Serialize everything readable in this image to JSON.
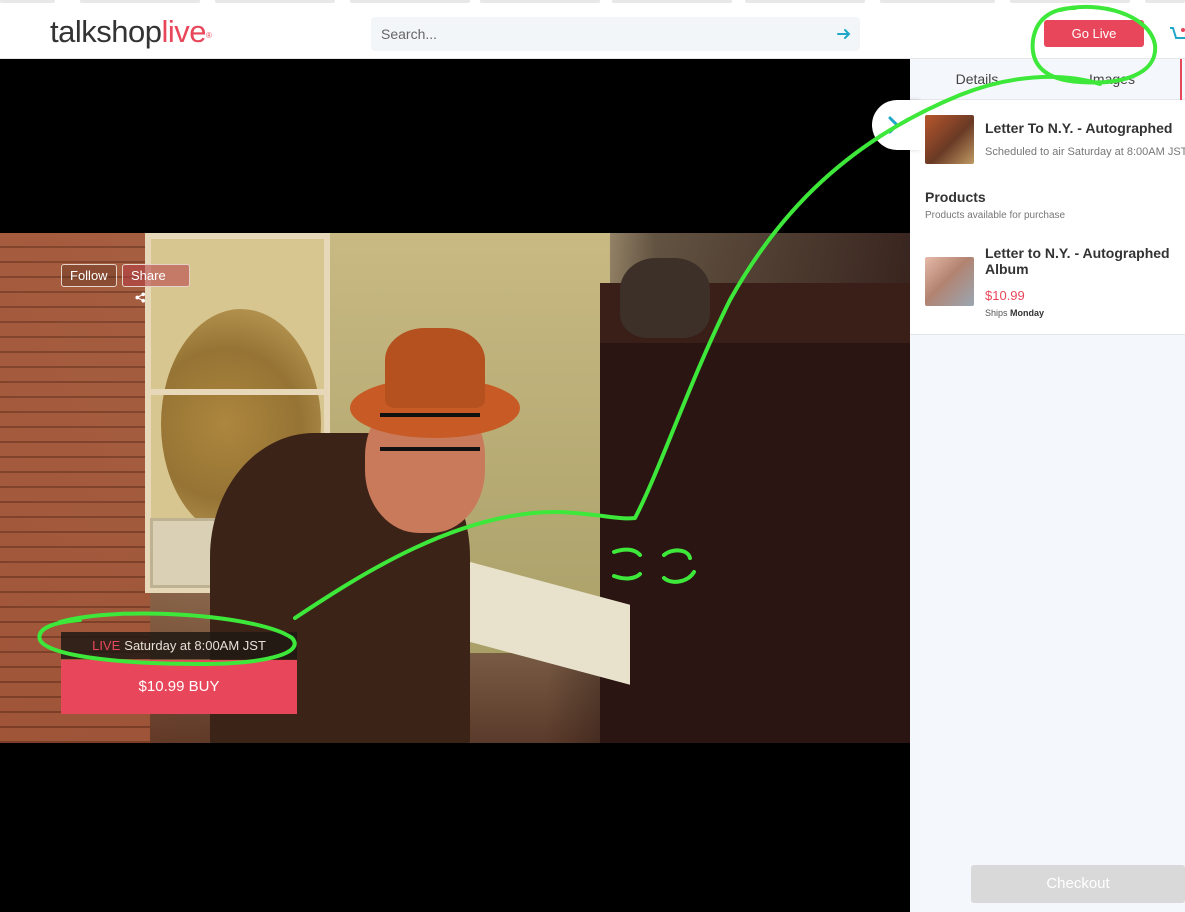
{
  "header": {
    "logo_main": "talkshop",
    "logo_accent": "live",
    "logo_reg": "®",
    "search_placeholder": "Search...",
    "go_live_label": "Go Live"
  },
  "video": {
    "follow_label": "Follow",
    "share_label": "Share",
    "live_tag": "LIVE",
    "schedule_text": "Saturday at 8:00AM JST",
    "buy_price": "$10.99",
    "buy_label": "BUY"
  },
  "sidebar": {
    "tabs": [
      {
        "label": "Details"
      },
      {
        "label": "Images"
      }
    ],
    "show": {
      "title": "Letter To N.Y. - Autographed",
      "subtitle": "Scheduled to air Saturday at 8:00AM JST"
    },
    "products_heading": "Products",
    "products_subheading": "Products available for purchase",
    "product": {
      "title": "Letter to N.Y. - Autographed Album",
      "price": "$10.99",
      "ships_prefix": "Ships",
      "ships_day": "Monday"
    },
    "checkout_label": "Checkout"
  },
  "colors": {
    "accent": "#e8475b",
    "annotation": "#3ee83a"
  },
  "icons": [
    "arrow-right-icon",
    "cart-icon",
    "share-icon",
    "chevron-right-icon"
  ]
}
